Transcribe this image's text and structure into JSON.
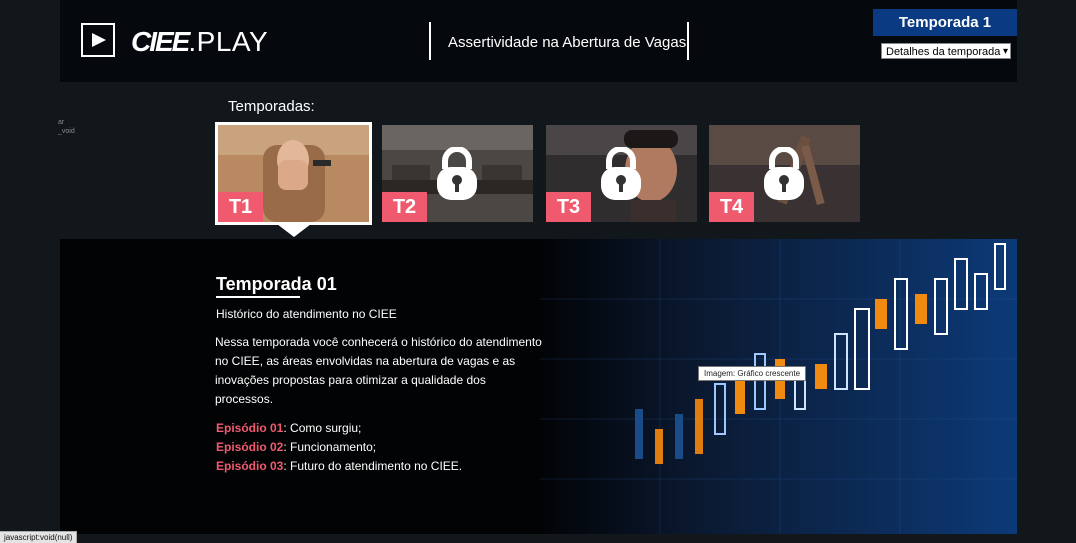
{
  "header": {
    "brand": "CIEE",
    "brand_suffix": ".PLAY",
    "title": "Assertividade na Abertura de Vagas",
    "season_button": "Temporada 1",
    "season_select": "Detalhes da temporada"
  },
  "fragment": [
    "ar",
    "_void"
  ],
  "seasons_label": "Temporadas:",
  "seasons": [
    {
      "tag": "T1",
      "locked": false,
      "selected": true
    },
    {
      "tag": "T2",
      "locked": true,
      "selected": false
    },
    {
      "tag": "T3",
      "locked": true,
      "selected": false
    },
    {
      "tag": "T4",
      "locked": true,
      "selected": false
    }
  ],
  "season_detail": {
    "title": "Temporada 01",
    "subtitle": "Histórico do atendimento no CIEE",
    "description": "Nessa temporada você conhecerá o histórico do atendimento no CIEE, as áreas envolvidas na abertura de vagas e as inovações propostas para otimizar a qualidade dos processos.",
    "episodes": [
      {
        "label": "Episódio 01",
        "text": ": Como surgiu;"
      },
      {
        "label": "Episódio 02",
        "text": ": Funcionamento;"
      },
      {
        "label": "Episódio 03",
        "text": ": Futuro do atendimento no CIEE."
      }
    ]
  },
  "tooltip": "Imagem: Gráfico crescente",
  "status_bar": "javascript:void(null)",
  "colors": {
    "accent": "#f05a6e",
    "button": "#0a3a82"
  }
}
